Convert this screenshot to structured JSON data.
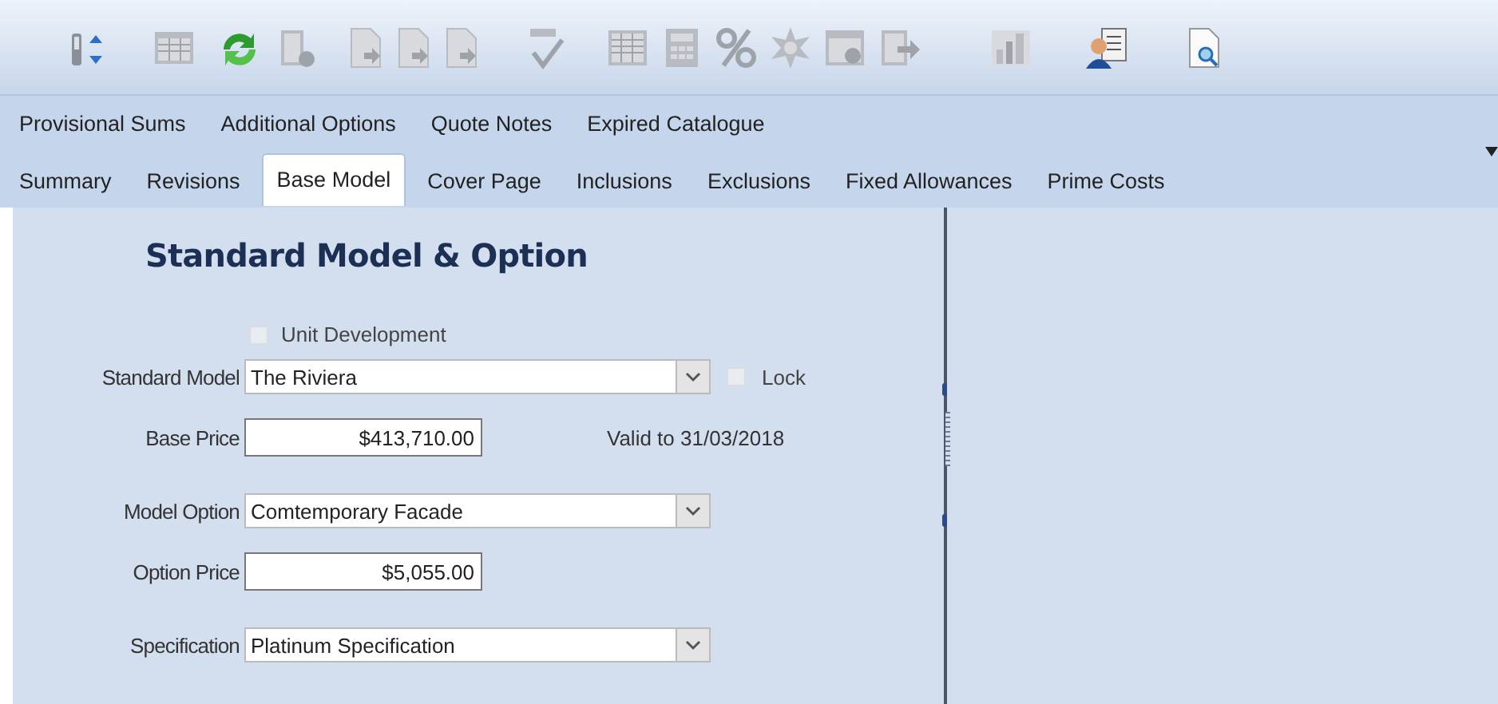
{
  "toolbar": [
    {
      "kind": "sort",
      "disabled": false
    },
    {
      "kind": "table",
      "disabled": true
    },
    {
      "kind": "refresh",
      "disabled": false
    },
    {
      "kind": "document",
      "disabled": true
    },
    {
      "kind": "page",
      "disabled": true
    },
    {
      "kind": "page",
      "disabled": true
    },
    {
      "kind": "page",
      "disabled": true
    },
    {
      "kind": "spellcheck",
      "disabled": true
    },
    {
      "kind": "grid",
      "disabled": true
    },
    {
      "kind": "calculator",
      "disabled": true
    },
    {
      "kind": "percent",
      "disabled": true
    },
    {
      "kind": "star",
      "disabled": true
    },
    {
      "kind": "calendar",
      "disabled": true
    },
    {
      "kind": "export",
      "disabled": true
    },
    {
      "kind": "chart",
      "disabled": true
    },
    {
      "kind": "person",
      "disabled": false
    },
    {
      "kind": "preview",
      "disabled": false
    }
  ],
  "tab_rows": [
    [
      {
        "label": "Provisional Sums",
        "selected": false
      },
      {
        "label": "Additional Options",
        "selected": false
      },
      {
        "label": "Quote Notes",
        "selected": false
      },
      {
        "label": "Expired Catalogue",
        "selected": false
      }
    ],
    [
      {
        "label": "Summary",
        "selected": false
      },
      {
        "label": "Revisions",
        "selected": false
      },
      {
        "label": "Base Model",
        "selected": true
      },
      {
        "label": "Cover Page",
        "selected": false
      },
      {
        "label": "Inclusions",
        "selected": false
      },
      {
        "label": "Exclusions",
        "selected": false
      },
      {
        "label": "Fixed Allowances",
        "selected": false
      },
      {
        "label": "Prime Costs",
        "selected": false
      }
    ]
  ],
  "section_title": "Standard Model & Option",
  "unit_development": {
    "label": "Unit Development",
    "checked": false,
    "disabled": true
  },
  "fields": [
    {
      "kind": "combo",
      "label": "Standard Model",
      "value": "The Riviera",
      "lock": {
        "label": "Lock",
        "checked": false,
        "disabled": true
      }
    },
    {
      "kind": "price",
      "label": "Base Price",
      "value": "$413,710.00",
      "note": "Valid to 31/03/2018"
    },
    {
      "kind": "combo",
      "label": "Model Option",
      "value": "Comtemporary Facade"
    },
    {
      "kind": "price",
      "label": "Option Price",
      "value": "$5,055.00"
    },
    {
      "kind": "combo",
      "label": "Specification",
      "value": "Platinum Specification"
    }
  ]
}
